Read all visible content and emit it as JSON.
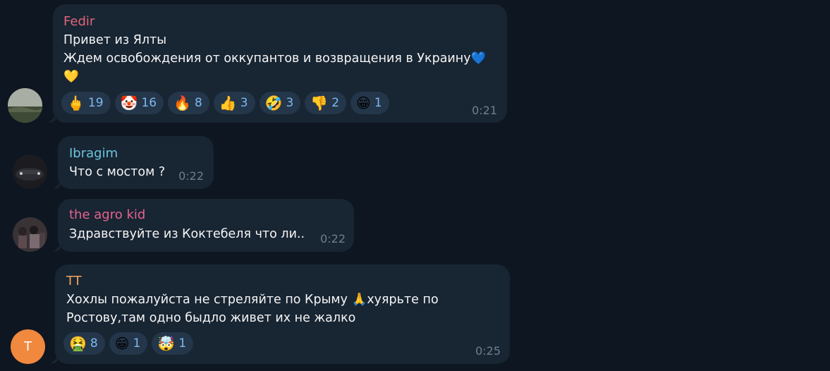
{
  "messages": [
    {
      "author": "Fedir",
      "author_color": "#e0677a",
      "lines": [
        "Привет из Ялты",
        "Ждем освобождения от оккупантов и возвращения в Украину💙",
        "💛"
      ],
      "time": "0:21",
      "reactions": [
        {
          "emoji": "🖕",
          "count": "19"
        },
        {
          "emoji": "🤡",
          "count": "16"
        },
        {
          "emoji": "🔥",
          "count": "8"
        },
        {
          "emoji": "👍",
          "count": "3"
        },
        {
          "emoji": "🤣",
          "count": "3"
        },
        {
          "emoji": "👎",
          "count": "2"
        },
        {
          "emoji": "😁",
          "count": "1"
        }
      ]
    },
    {
      "author": "Ibragim",
      "author_color": "#6cc5dc",
      "lines": [
        "Что с мостом ?"
      ],
      "time": "0:22"
    },
    {
      "author": "the agro kid",
      "author_color": "#e5638f",
      "lines": [
        "Здравствуйте из Коктебеля что ли.."
      ],
      "time": "0:22"
    },
    {
      "author": "TT",
      "author_color": "#f0a35e",
      "avatar_letter": "T",
      "lines": [
        "Хохлы пожалуйста не стреляйте по Крыму 🙏хуярьте по",
        "Ростову,там одно быдло живет их не жалко"
      ],
      "time": "0:25",
      "reactions": [
        {
          "emoji": "🤮",
          "count": "8"
        },
        {
          "emoji": "😁",
          "count": "1"
        },
        {
          "emoji": "🤯",
          "count": "1"
        }
      ]
    }
  ],
  "colors": {
    "background": "#0e1621",
    "bubble": "#182533",
    "reaction_bg": "#24364a",
    "reaction_count": "#7fb8ef",
    "time": "#6d7f8f",
    "tt_avatar": "#f0883e"
  }
}
